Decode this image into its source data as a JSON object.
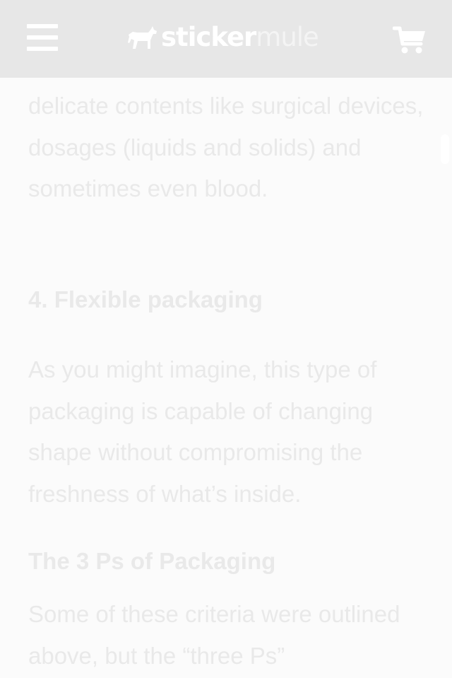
{
  "header": {
    "logo": {
      "word1": "sticker",
      "word2": "mule"
    },
    "menu_icon": "hamburger-icon",
    "cart_icon": "shopping-cart-icon",
    "colors": {
      "bar": "#e7e7e7",
      "icons": "#ffffff"
    }
  },
  "article": {
    "para_top": "delicate contents like surgical devices, dosages (liquids and solids) and sometimes even blood.",
    "heading_flexible": "4. Flexible packaging",
    "para_flexible": "As you might imagine, this type of packaging is capable of changing shape without compromising the freshness of what’s inside.",
    "heading_3ps": "The 3 Ps of Packaging",
    "para_3ps": "Some of these criteria were outlined above, but the “three Ps”"
  }
}
